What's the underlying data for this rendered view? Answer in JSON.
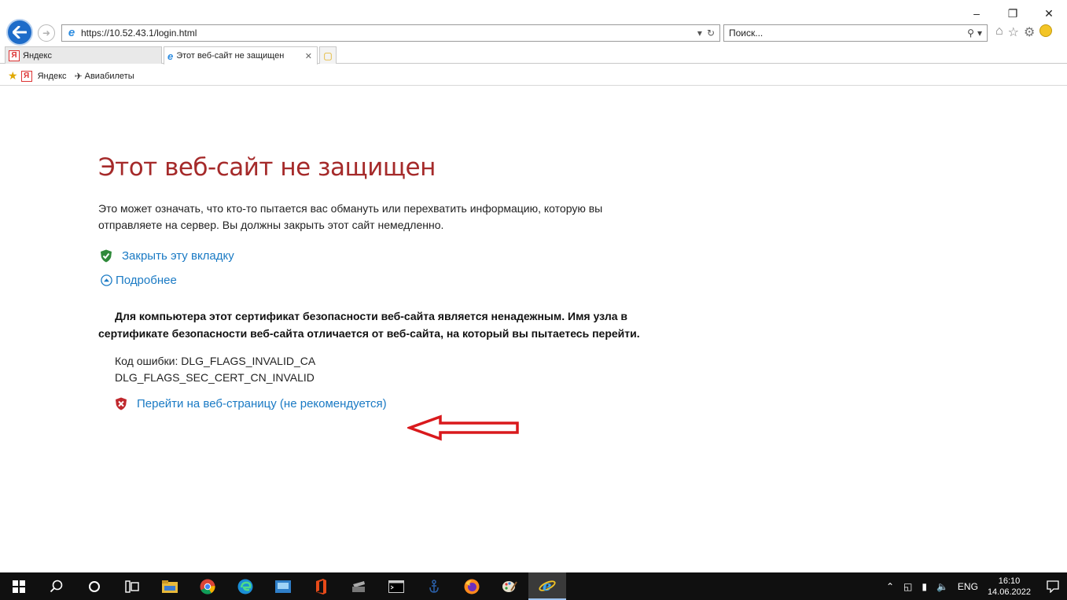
{
  "window": {
    "minimize_icon": "minimize-icon",
    "restore_icon": "restore-icon",
    "close_icon": "close-icon"
  },
  "address_bar": {
    "url": "https://10.52.43.1/login.html"
  },
  "search": {
    "placeholder": "Поиск..."
  },
  "tabs": [
    {
      "label": "Яндекс",
      "active": false
    },
    {
      "label": "Этот веб-сайт не защищен",
      "active": true
    }
  ],
  "favorites": [
    {
      "label": "Яндекс",
      "icon": "yandex-icon"
    },
    {
      "label": "Авиабилеты",
      "icon": "plane-icon"
    }
  ],
  "page": {
    "title": "Этот веб-сайт не защищен",
    "description": "Это может означать, что кто-то пытается вас обмануть или перехватить информацию, которую вы отправляете на сервер. Вы должны закрыть этот сайт немедленно.",
    "close_tab_label": "Закрыть эту вкладку",
    "more_info_label": "Подробнее",
    "warning_line1": "Для компьютера этот сертификат безопасности веб-сайта является ненадежным.",
    "warning_line2": "Имя узла в сертификате безопасности веб-сайта отличается от веб-сайта, на который вы пытаетесь перейти.",
    "error_code_line1": "Код ошибки: DLG_FLAGS_INVALID_CA",
    "error_code_line2": "DLG_FLAGS_SEC_CERT_CN_INVALID",
    "continue_label": "Перейти на веб-страницу (не рекомендуется)"
  },
  "colors": {
    "title": "#a52a2a",
    "link": "#1a7ac4",
    "arrow": "#d9191c",
    "taskbar": "#101010"
  },
  "taskbar": {
    "language": "ENG",
    "time": "16:10",
    "date": "14.06.2022"
  }
}
